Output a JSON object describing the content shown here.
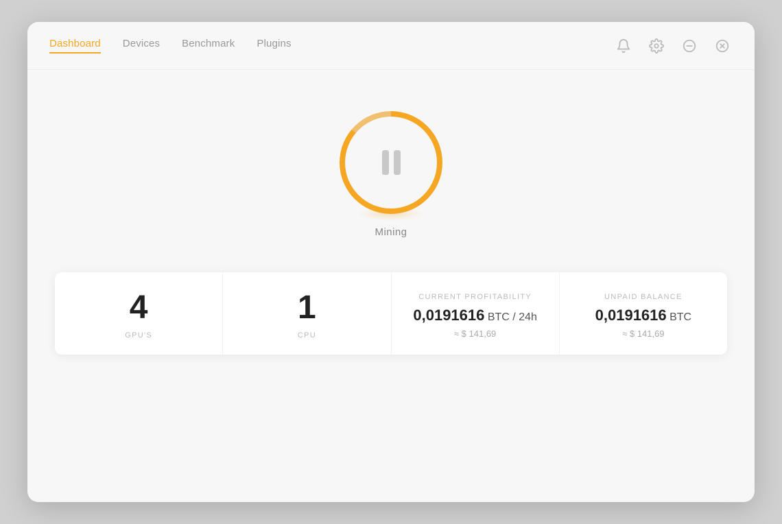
{
  "nav": {
    "items": [
      {
        "id": "dashboard",
        "label": "Dashboard",
        "active": true
      },
      {
        "id": "devices",
        "label": "Devices",
        "active": false
      },
      {
        "id": "benchmark",
        "label": "Benchmark",
        "active": false
      },
      {
        "id": "plugins",
        "label": "Plugins",
        "active": false
      }
    ],
    "icons": [
      {
        "id": "notification",
        "symbol": "🔔",
        "label": "Notifications"
      },
      {
        "id": "settings",
        "symbol": "⚙",
        "label": "Settings"
      },
      {
        "id": "minimize",
        "symbol": "—",
        "label": "Minimize"
      },
      {
        "id": "close",
        "symbol": "✕",
        "label": "Close"
      }
    ]
  },
  "mining": {
    "button_label": "Mining",
    "state": "paused"
  },
  "stats": [
    {
      "id": "gpus",
      "number": "4",
      "unit": "GPU'S"
    },
    {
      "id": "cpu",
      "number": "1",
      "unit": "CPU"
    },
    {
      "id": "profitability",
      "label": "CURRENT PROFITABILITY",
      "value": "0,0191616",
      "value_suffix": " BTC / 24h",
      "sub": "≈ $ 141,69"
    },
    {
      "id": "balance",
      "label": "UNPAID BALANCE",
      "value": "0,0191616",
      "value_suffix": " BTC",
      "sub": "≈ $ 141,69"
    }
  ]
}
